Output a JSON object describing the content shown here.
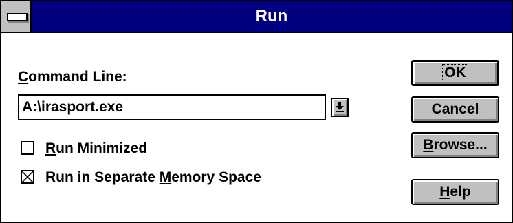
{
  "window": {
    "title": "Run"
  },
  "command_line": {
    "label_accel": "C",
    "label_rest": "ommand Line:",
    "value": "A:\\irasport.exe"
  },
  "run_minimized": {
    "label_accel": "R",
    "label_rest": "un Minimized",
    "checked": false
  },
  "separate_memory": {
    "label_pre": "Run in Separate ",
    "label_accel": "M",
    "label_post": "emory Space",
    "checked": true
  },
  "buttons": {
    "ok": "OK",
    "cancel": "Cancel",
    "browse_accel": "B",
    "browse_rest": "rowse...",
    "help_accel": "H",
    "help_rest": "elp"
  },
  "colors": {
    "titlebar": "#000080",
    "face": "#c0c0c0"
  }
}
